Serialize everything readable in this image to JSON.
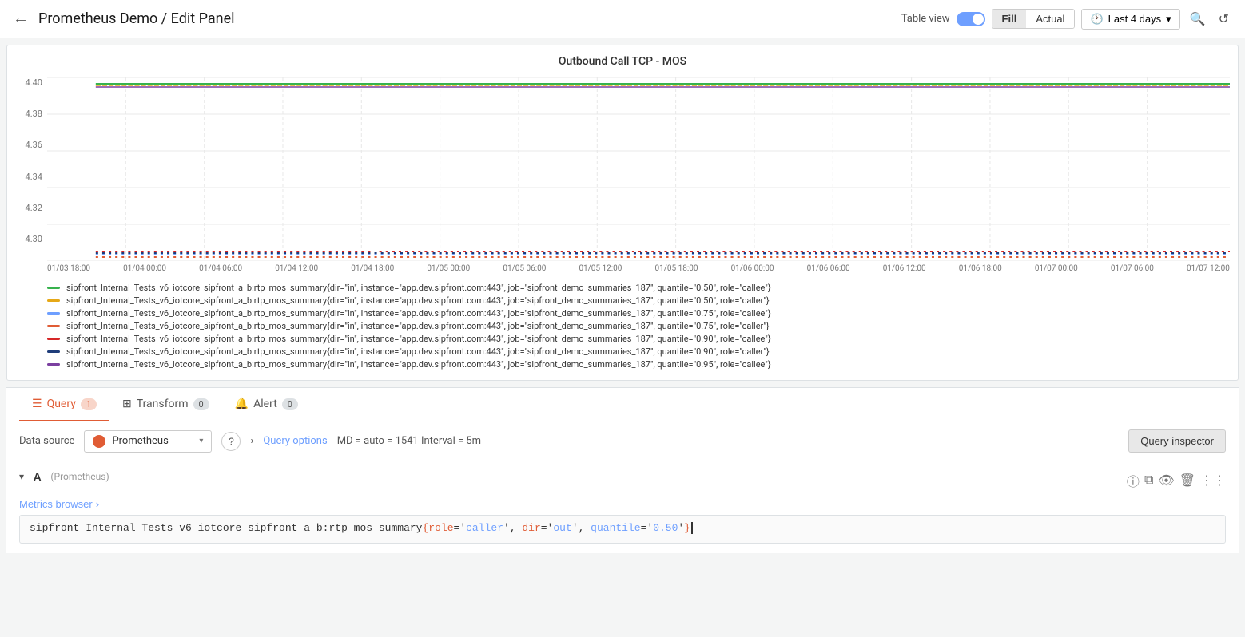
{
  "header": {
    "back_label": "←",
    "title": "Prometheus Demo / Edit Panel",
    "table_view_label": "Table view",
    "fill_label": "Fill",
    "actual_label": "Actual",
    "time_range_label": "Last 4 days",
    "zoom_icon": "🔍",
    "refresh_icon": "↺"
  },
  "chart": {
    "title": "Outbound Call TCP - MOS",
    "y_labels": [
      "4.40",
      "4.38",
      "4.36",
      "4.34",
      "4.32",
      "4.30"
    ],
    "x_labels": [
      "01/03 18:00",
      "01/04 00:00",
      "01/04 06:00",
      "01/04 12:00",
      "01/04 18:00",
      "01/05 00:00",
      "01/05 06:00",
      "01/05 12:00",
      "01/05 18:00",
      "01/06 00:00",
      "01/06 06:00",
      "01/06 12:00",
      "01/06 18:00",
      "01/07 00:00",
      "01/07 06:00",
      "01/07 12:00"
    ],
    "legend": [
      {
        "color": "#37b24d",
        "text": "sipfront_Internal_Tests_v6_iotcore_sipfront_a_b:rtp_mos_summary{dir=\"in\", instance=\"app.dev.sipfront.com:443\", job=\"sipfront_demo_summaries_187\", quantile=\"0.50\", role=\"callee\"}"
      },
      {
        "color": "#e6a817",
        "text": "sipfront_Internal_Tests_v6_iotcore_sipfront_a_b:rtp_mos_summary{dir=\"in\", instance=\"app.dev.sipfront.com:443\", job=\"sipfront_demo_summaries_187\", quantile=\"0.50\", role=\"caller\"}"
      },
      {
        "color": "#6e9fff",
        "text": "sipfront_Internal_Tests_v6_iotcore_sipfront_a_b:rtp_mos_summary{dir=\"in\", instance=\"app.dev.sipfront.com:443\", job=\"sipfront_demo_summaries_187\", quantile=\"0.75\", role=\"callee\"}"
      },
      {
        "color": "#e05c35",
        "text": "sipfront_Internal_Tests_v6_iotcore_sipfront_a_b:rtp_mos_summary{dir=\"in\", instance=\"app.dev.sipfront.com:443\", job=\"sipfront_demo_summaries_187\", quantile=\"0.75\", role=\"caller\"}"
      },
      {
        "color": "#d62728",
        "text": "sipfront_Internal_Tests_v6_iotcore_sipfront_a_b:rtp_mos_summary{dir=\"in\", instance=\"app.dev.sipfront.com:443\", job=\"sipfront_demo_summaries_187\", quantile=\"0.90\", role=\"callee\"}"
      },
      {
        "color": "#1f3d7a",
        "text": "sipfront_Internal_Tests_v6_iotcore_sipfront_a_b:rtp_mos_summary{dir=\"in\", instance=\"app.dev.sipfront.com:443\", job=\"sipfront_demo_summaries_187\", quantile=\"0.90\", role=\"caller\"}"
      },
      {
        "color": "#7b3fa0",
        "text": "sipfront_Internal_Tests_v6_iotcore_sipfront_a_b:rtp_mos_summary{dir=\"in\", instance=\"app.dev.sipfront.com:443\", job=\"sipfront_demo_summaries_187\", quantile=\"0.95\", role=\"callee\"}"
      }
    ]
  },
  "query_section": {
    "tabs": [
      {
        "label": "Query",
        "badge": "1",
        "icon": "☰"
      },
      {
        "label": "Transform",
        "badge": "0",
        "icon": "⊞"
      },
      {
        "label": "Alert",
        "badge": "0",
        "icon": "🔔"
      }
    ],
    "datasource_label": "Data source",
    "datasource_name": "Prometheus",
    "query_options_label": "Query options",
    "query_options_meta": "MD = auto = 1541    Interval = 5m",
    "query_inspector_label": "Query inspector",
    "query_letter": "A",
    "query_source": "(Prometheus)",
    "metrics_browser_label": "Metrics browser",
    "metrics_browser_chevron": "›",
    "query_text_prefix": "sipfront_Internal_Tests_v6_iotcore_sipfront_a_b:rtp_mos_summary",
    "query_label_part": "{role='caller', dir='out', ",
    "query_quantile_key": "quantile",
    "query_quantile_value": "'0.50'",
    "query_closing": "}"
  }
}
